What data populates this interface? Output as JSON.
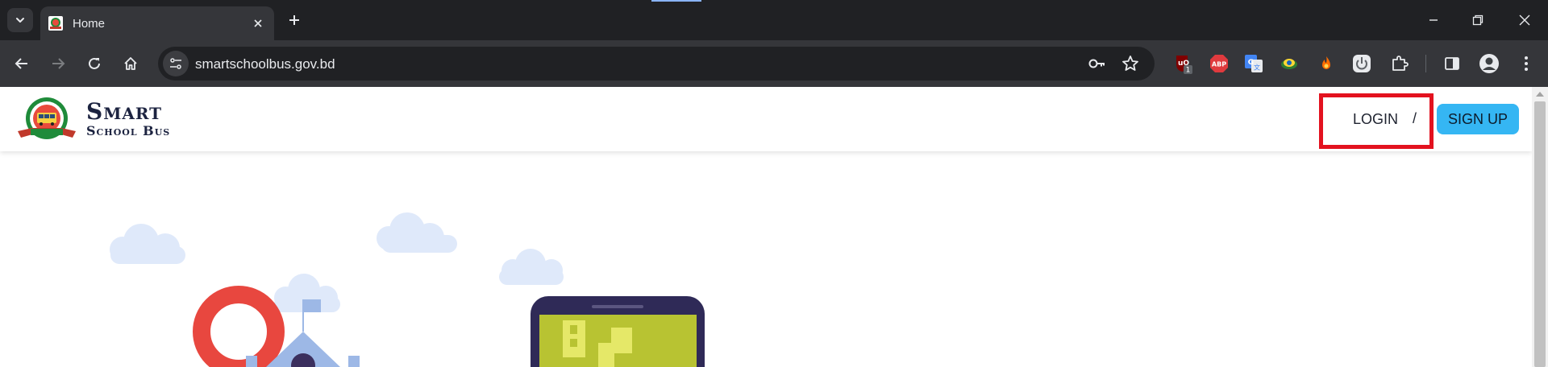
{
  "browser": {
    "tab": {
      "title": "Home"
    },
    "omnibox": {
      "url": "smartschoolbus.gov.bd"
    },
    "extensions": [
      {
        "name": "ublock-icon",
        "badge": "1"
      },
      {
        "name": "abp-icon",
        "label": "ABP"
      },
      {
        "name": "google-translate-icon"
      },
      {
        "name": "globe-extension-icon"
      },
      {
        "name": "fire-extension-icon"
      },
      {
        "name": "power-extension-icon"
      },
      {
        "name": "puzzle-icon"
      }
    ],
    "colors": {
      "frame": "#202124",
      "toolbar": "#35363a",
      "omnibox": "#202124",
      "text": "#e8eaed"
    }
  },
  "site": {
    "logo": {
      "line1": "Smart",
      "line2": "School Bus",
      "emblem": "bus-emblem-logo"
    },
    "nav": {
      "login": "LOGIN",
      "separator": "/",
      "signup": "SIGN UP"
    },
    "colors": {
      "brand_text": "#1c2340",
      "signup_bg": "#35b6f3",
      "highlight": "#e3121f"
    }
  }
}
